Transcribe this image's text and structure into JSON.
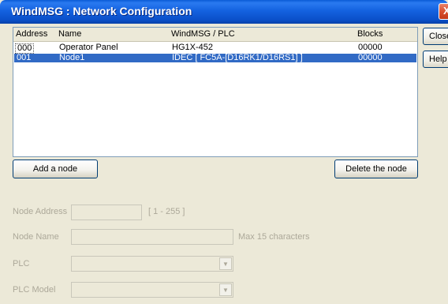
{
  "window": {
    "title": "WindMSG : Network Configuration",
    "close_glyph": "X"
  },
  "list": {
    "columns": [
      "Address",
      "Name",
      "WindMSG / PLC",
      "Blocks"
    ],
    "rows": [
      {
        "address": "000",
        "name": "Operator Panel",
        "plc": "HG1X-452",
        "blocks": "00000"
      },
      {
        "address": "001",
        "name": "Node1",
        "plc": "IDEC  [ FC5A-[D16RK1/D16RS1] ]",
        "blocks": "00000"
      }
    ],
    "selected_row": 1
  },
  "side_buttons": {
    "close": "Close",
    "help": "Help"
  },
  "buttons": {
    "add": "Add a node",
    "delete": "Delete the node"
  },
  "form": {
    "node_address_label": "Node Address",
    "node_address_hint": "[ 1 - 255 ]",
    "node_name_label": "Node Name",
    "node_name_hint": "Max 15 characters",
    "plc_label": "PLC",
    "plc_model_label": "PLC Model",
    "combo_arrow": "▼"
  }
}
